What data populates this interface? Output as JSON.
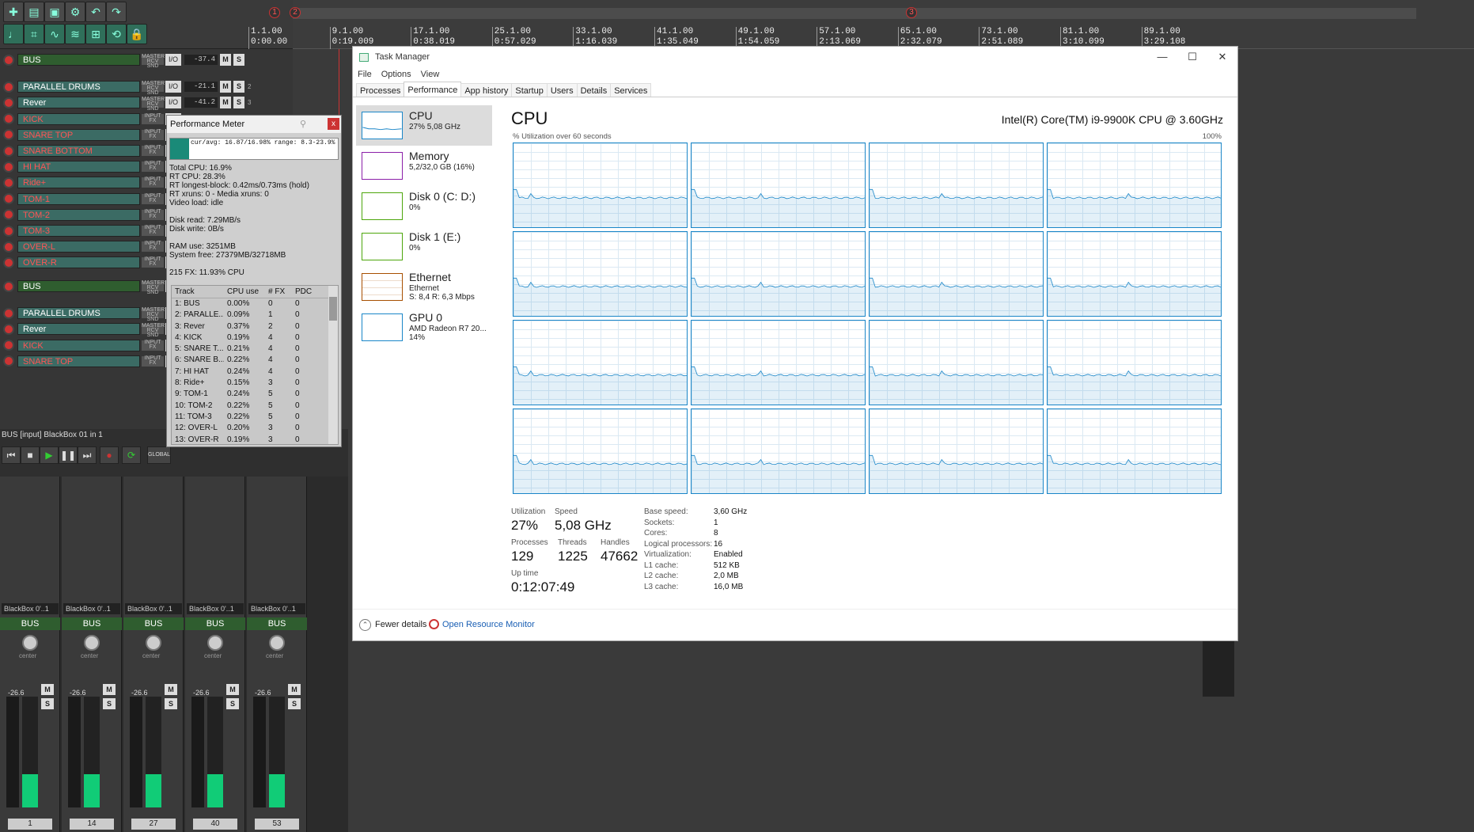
{
  "toolbar": {
    "icons": [
      "new-icon",
      "open-icon",
      "save-icon",
      "settings-icon",
      "undo-icon",
      "redo-icon",
      "metronome-icon",
      "grid-icon",
      "envelope-icon",
      "ripple-icon",
      "snap-icon",
      "loop-icon",
      "lock-icon"
    ]
  },
  "ruler": {
    "markers": [
      "1",
      "2",
      "3"
    ],
    "ticks": [
      {
        "bar": "1.1.00",
        "time": "0:00.00"
      },
      {
        "bar": "9.1.00",
        "time": "0:19.009"
      },
      {
        "bar": "17.1.00",
        "time": "0:38.019"
      },
      {
        "bar": "25.1.00",
        "time": "0:57.029"
      },
      {
        "bar": "33.1.00",
        "time": "1:16.039"
      },
      {
        "bar": "41.1.00",
        "time": "1:35.049"
      },
      {
        "bar": "49.1.00",
        "time": "1:54.059"
      },
      {
        "bar": "57.1.00",
        "time": "2:13.069"
      },
      {
        "bar": "65.1.00",
        "time": "2:32.079"
      },
      {
        "bar": "73.1.00",
        "time": "2:51.089"
      },
      {
        "bar": "81.1.00",
        "time": "3:10.099"
      },
      {
        "bar": "89.1.00",
        "time": "3:29.108"
      }
    ]
  },
  "tracks": [
    {
      "name": "BUS",
      "type": "bus",
      "vol": "-37.4",
      "num": ""
    },
    {
      "name": "PARALLEL DRUMS",
      "type": "normal",
      "vol": "-21.1",
      "num": "2"
    },
    {
      "name": "Rever",
      "type": "normal",
      "vol": "-41.2",
      "num": "3"
    },
    {
      "name": "KICK",
      "type": "red",
      "vol": "",
      "num": ""
    },
    {
      "name": "SNARE TOP",
      "type": "red",
      "vol": "",
      "num": ""
    },
    {
      "name": "SNARE BOTTOM",
      "type": "red",
      "vol": "",
      "num": ""
    },
    {
      "name": "HI HAT",
      "type": "red",
      "vol": "",
      "num": ""
    },
    {
      "name": "Ride+",
      "type": "red",
      "vol": "",
      "num": ""
    },
    {
      "name": "TOM-1",
      "type": "red",
      "vol": "",
      "num": ""
    },
    {
      "name": "TOM-2",
      "type": "red",
      "vol": "",
      "num": ""
    },
    {
      "name": "TOM-3",
      "type": "red",
      "vol": "",
      "num": ""
    },
    {
      "name": "OVER-L",
      "type": "red",
      "vol": "",
      "num": ""
    },
    {
      "name": "OVER-R",
      "type": "red",
      "vol": "",
      "num": ""
    },
    {
      "name": "BUS",
      "type": "bus",
      "vol": "",
      "num": ""
    },
    {
      "name": "PARALLEL DRUMS",
      "type": "normal",
      "vol": "",
      "num": ""
    },
    {
      "name": "Rever",
      "type": "normal",
      "vol": "",
      "num": ""
    },
    {
      "name": "KICK",
      "type": "red",
      "vol": "",
      "num": ""
    },
    {
      "name": "SNARE TOP",
      "type": "red",
      "vol": "",
      "num": ""
    }
  ],
  "track_labels": {
    "master": "MASTER",
    "rcv": "RCV SND",
    "input": "INPUT",
    "fx": "FX",
    "io": "I/O",
    "m": "M",
    "s": "S"
  },
  "transport": {
    "info": "BUS [input] BlackBox 01 in 1",
    "global": "GLOBAL"
  },
  "mixer": {
    "strips": [
      {
        "plugin": "BlackBox 0'..1",
        "name": "BUS",
        "db": "-26.6",
        "num": "1"
      },
      {
        "plugin": "BlackBox 0'..1",
        "name": "BUS",
        "db": "-26.6",
        "num": "14"
      },
      {
        "plugin": "BlackBox 0'..1",
        "name": "BUS",
        "db": "-26.6",
        "num": "27"
      },
      {
        "plugin": "BlackBox 0'..1",
        "name": "BUS",
        "db": "-26.6",
        "num": "40"
      },
      {
        "plugin": "BlackBox 0'..1",
        "name": "BUS",
        "db": "-26.6",
        "num": "53"
      }
    ],
    "center": "center"
  },
  "perf_meter": {
    "title": "Performance Meter",
    "graph_text": "cur/avg: 16.87/16.98%  range: 8.3-23.9%",
    "stats": "Total CPU: 16.9%\nRT CPU: 28.3%\nRT longest-block: 0.42ms/0.73ms (hold)\nRT xruns: 0 - Media xruns: 0\nVideo load: idle\n\nDisk read: 7.29MB/s\nDisk write: 0B/s\n\nRAM use: 3251MB\nSystem free: 27379MB/32718MB\n\n215 FX: 11.93% CPU",
    "headers": [
      "Track",
      "CPU use",
      "# FX",
      "PDC"
    ],
    "rows": [
      [
        "1: BUS",
        "0.00%",
        "0",
        "0"
      ],
      [
        "2: PARALLE...",
        "0.09%",
        "1",
        "0"
      ],
      [
        "3: Rever",
        "0.37%",
        "2",
        "0"
      ],
      [
        "4: KICK",
        "0.19%",
        "4",
        "0"
      ],
      [
        "5: SNARE T...",
        "0.21%",
        "4",
        "0"
      ],
      [
        "6: SNARE B...",
        "0.22%",
        "4",
        "0"
      ],
      [
        "7: HI HAT",
        "0.24%",
        "4",
        "0"
      ],
      [
        "8: Ride+",
        "0.15%",
        "3",
        "0"
      ],
      [
        "9: TOM-1",
        "0.24%",
        "5",
        "0"
      ],
      [
        "10: TOM-2",
        "0.22%",
        "5",
        "0"
      ],
      [
        "11: TOM-3",
        "0.22%",
        "5",
        "0"
      ],
      [
        "12: OVER-L",
        "0.20%",
        "3",
        "0"
      ],
      [
        "13: OVER-R",
        "0.19%",
        "3",
        "0"
      ]
    ]
  },
  "taskmgr": {
    "title": "Task Manager",
    "menu": [
      "File",
      "Options",
      "View"
    ],
    "win": [
      "—",
      "☐",
      "✕"
    ],
    "tabs": [
      "Processes",
      "Performance",
      "App history",
      "Startup",
      "Users",
      "Details",
      "Services"
    ],
    "active_tab": 1,
    "resources": [
      {
        "name": "CPU",
        "sub": "27% 5,08 GHz",
        "sub2": "",
        "color": "#1a86c8",
        "active": true
      },
      {
        "name": "Memory",
        "sub": "5,2/32,0 GB (16%)",
        "sub2": "",
        "color": "#8b1fa8",
        "active": false
      },
      {
        "name": "Disk 0 (C: D:)",
        "sub": "0%",
        "sub2": "",
        "color": "#4da60c",
        "active": false
      },
      {
        "name": "Disk 1 (E:)",
        "sub": "0%",
        "sub2": "",
        "color": "#4da60c",
        "active": false
      },
      {
        "name": "Ethernet",
        "sub": "Ethernet",
        "sub2": "S: 8,4  R: 6,3 Mbps",
        "color": "#a74f01",
        "active": false
      },
      {
        "name": "GPU 0",
        "sub": "AMD Radeon R7 20...",
        "sub2": "14%",
        "color": "#1a86c8",
        "active": false
      }
    ],
    "cpu": {
      "heading": "CPU",
      "model": "Intel(R) Core(TM) i9-9900K CPU @ 3.60GHz",
      "util_label": "% Utilization over 60 seconds",
      "max_label": "100%"
    },
    "stats": {
      "utilization_label": "Utilization",
      "utilization": "27%",
      "speed_label": "Speed",
      "speed": "5,08 GHz",
      "processes_label": "Processes",
      "processes": "129",
      "threads_label": "Threads",
      "threads": "1225",
      "handles_label": "Handles",
      "handles": "47662",
      "uptime_label": "Up time",
      "uptime": "0:12:07:49"
    },
    "specs": [
      [
        "Base speed:",
        "3,60 GHz"
      ],
      [
        "Sockets:",
        "1"
      ],
      [
        "Cores:",
        "8"
      ],
      [
        "Logical processors:",
        "16"
      ],
      [
        "Virtualization:",
        "Enabled"
      ],
      [
        "L1 cache:",
        "512 KB"
      ],
      [
        "L2 cache:",
        "2,0 MB"
      ],
      [
        "L3 cache:",
        "16,0 MB"
      ]
    ],
    "footer": {
      "fewer": "Fewer details",
      "orm": "Open Resource Monitor"
    }
  }
}
